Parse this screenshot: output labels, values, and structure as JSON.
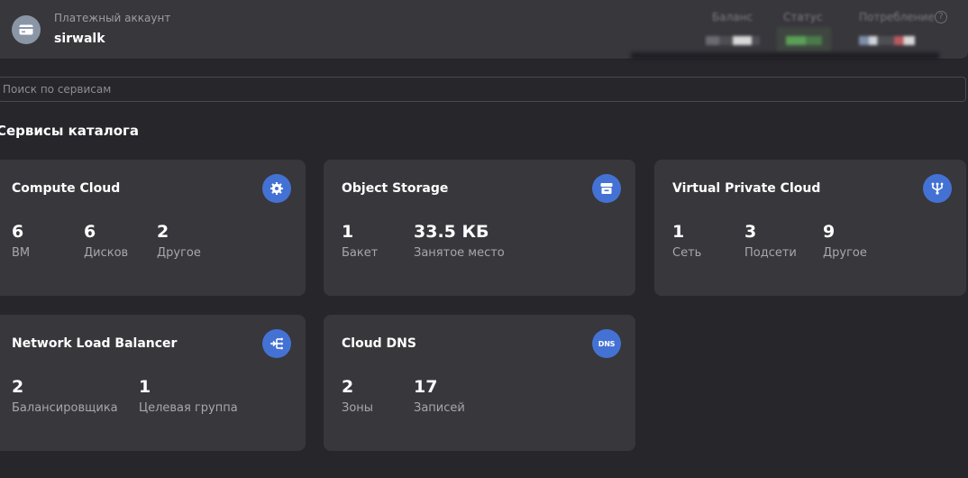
{
  "billing": {
    "label": "Платежный аккаунт",
    "name": "sirwalk",
    "balance_label": "Баланс",
    "status_label": "Статус",
    "consumption_label": "Потребление",
    "help": "?"
  },
  "search": {
    "placeholder": "Поиск по сервисам"
  },
  "section_title": "Сервисы каталога",
  "cards": [
    {
      "title": "Compute Cloud",
      "icon": "chip-icon",
      "metrics": [
        {
          "value": "6",
          "label": "ВМ"
        },
        {
          "value": "6",
          "label": "Дисков"
        },
        {
          "value": "2",
          "label": "Другое"
        }
      ]
    },
    {
      "title": "Object Storage",
      "icon": "storage-icon",
      "metrics": [
        {
          "value": "1",
          "label": "Бакет"
        },
        {
          "value": "33.5 КБ",
          "label": "Занятое место"
        }
      ]
    },
    {
      "title": "Virtual Private Cloud",
      "icon": "network-icon",
      "metrics": [
        {
          "value": "1",
          "label": "Сеть"
        },
        {
          "value": "3",
          "label": "Подсети"
        },
        {
          "value": "9",
          "label": "Другое"
        }
      ]
    },
    {
      "title": "Network Load Balancer",
      "icon": "balancer-icon",
      "metrics": [
        {
          "value": "2",
          "label": "Балансировщика"
        },
        {
          "value": "1",
          "label": "Целевая группа"
        }
      ]
    },
    {
      "title": "Cloud DNS",
      "icon": "dns-icon",
      "icon_text": "DNS",
      "metrics": [
        {
          "value": "2",
          "label": "Зоны"
        },
        {
          "value": "17",
          "label": "Записей"
        }
      ]
    }
  ],
  "colors": {
    "background": "#27262b",
    "card": "#38373c",
    "accent": "#4472d4",
    "muted_text": "#a8a7ac"
  }
}
